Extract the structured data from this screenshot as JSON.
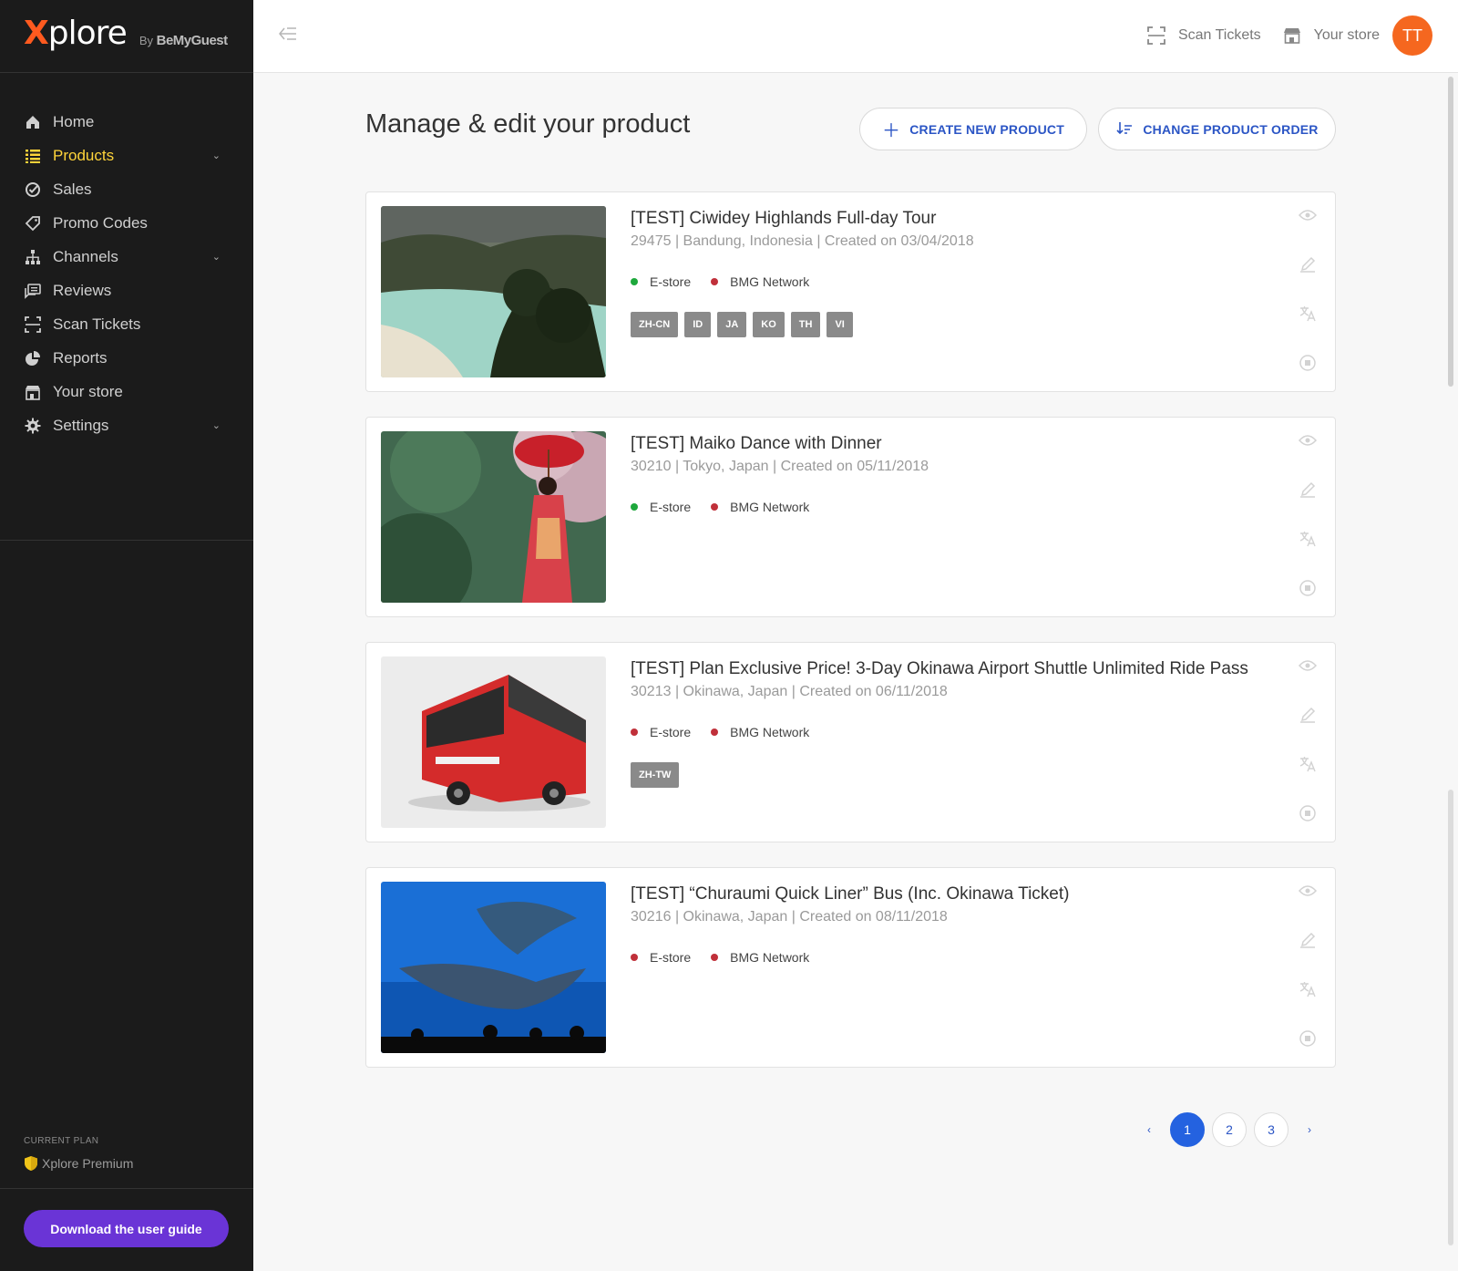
{
  "brand": {
    "logo_x": "X",
    "logo_rest": "plore",
    "by": "By",
    "by_brand": "BeMyGuest"
  },
  "sidebar": {
    "items": [
      {
        "label": "Home",
        "icon": "home-icon"
      },
      {
        "label": "Products",
        "icon": "list-icon",
        "active": true,
        "chevron": true
      },
      {
        "label": "Sales",
        "icon": "check-circle-icon"
      },
      {
        "label": "Promo Codes",
        "icon": "tag-icon"
      },
      {
        "label": "Channels",
        "icon": "sitemap-icon",
        "chevron": true
      },
      {
        "label": "Reviews",
        "icon": "reviews-icon"
      },
      {
        "label": "Scan Tickets",
        "icon": "scan-icon"
      },
      {
        "label": "Reports",
        "icon": "pie-chart-icon"
      },
      {
        "label": "Your store",
        "icon": "store-icon"
      },
      {
        "label": "Settings",
        "icon": "gear-icon",
        "chevron": true
      }
    ],
    "plan_caption": "CURRENT PLAN",
    "plan_name": "Xplore Premium",
    "guide_button": "Download the user guide"
  },
  "topbar": {
    "scan_label": "Scan Tickets",
    "store_label": "Your store",
    "avatar_initials": "TT"
  },
  "main": {
    "title": "Manage & edit your product",
    "create_button": "CREATE NEW PRODUCT",
    "order_button": "CHANGE PRODUCT ORDER"
  },
  "products": [
    {
      "title": "[TEST] Ciwidey Highlands Full-day Tour",
      "meta": "29475 | Bandung, Indonesia | Created on 03/04/2018",
      "channels": [
        {
          "label": "E-store",
          "color": "#1ea83c"
        },
        {
          "label": "BMG Network",
          "color": "#c0303a"
        }
      ],
      "languages": [
        "ZH-CN",
        "ID",
        "JA",
        "KO",
        "TH",
        "VI"
      ]
    },
    {
      "title": "[TEST] Maiko Dance with Dinner",
      "meta": "30210 | Tokyo, Japan | Created on 05/11/2018",
      "channels": [
        {
          "label": "E-store",
          "color": "#1ea83c"
        },
        {
          "label": "BMG Network",
          "color": "#c0303a"
        }
      ],
      "languages": []
    },
    {
      "title": "[TEST] Plan Exclusive Price! 3-Day Okinawa Airport Shuttle Unlimited Ride Pass",
      "meta": "30213 | Okinawa, Japan | Created on 06/11/2018",
      "channels": [
        {
          "label": "E-store",
          "color": "#c0303a"
        },
        {
          "label": "BMG Network",
          "color": "#c0303a"
        }
      ],
      "languages": [
        "ZH-TW"
      ]
    },
    {
      "title": "[TEST] “Churaumi Quick Liner” Bus (Inc. Okinawa Ticket)",
      "meta": "30216 | Okinawa, Japan | Created on 08/11/2018",
      "channels": [
        {
          "label": "E-store",
          "color": "#c0303a"
        },
        {
          "label": "BMG Network",
          "color": "#c0303a"
        }
      ],
      "languages": []
    }
  ],
  "pagination": {
    "prev": "‹",
    "pages": [
      "1",
      "2",
      "3"
    ],
    "current": "1",
    "next": "›"
  }
}
